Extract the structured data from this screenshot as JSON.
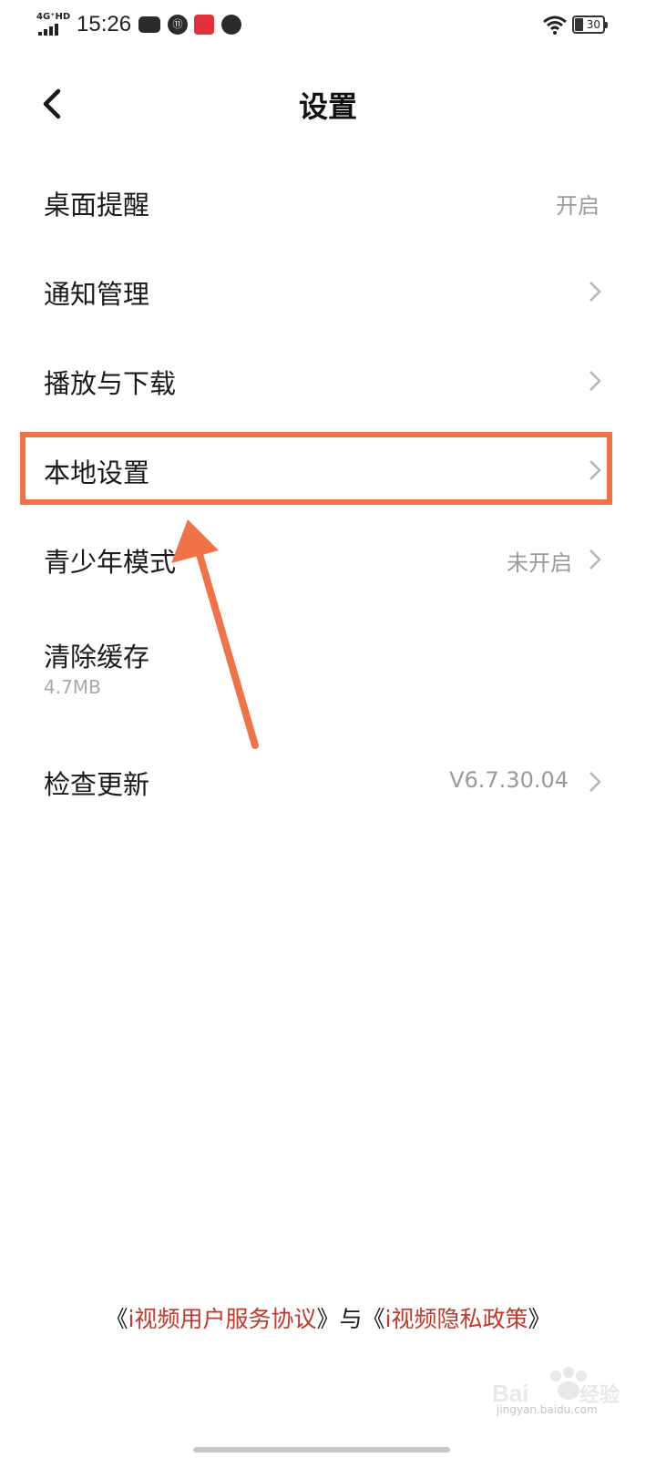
{
  "status_bar": {
    "network": "4G⁺HD",
    "time": "15:26",
    "battery": "30",
    "icons": [
      "car-icon",
      "one-badge-icon",
      "app-red-icon",
      "globe-icon",
      "wifi-icon",
      "battery-icon"
    ]
  },
  "header": {
    "title": "设置",
    "back_icon": "chevron-left-icon"
  },
  "settings": {
    "items": [
      {
        "label": "桌面提醒",
        "value": "开启"
      },
      {
        "label": "通知管理",
        "value": ""
      },
      {
        "label": "播放与下载",
        "value": ""
      },
      {
        "label": "本地设置",
        "value": ""
      },
      {
        "label": "青少年模式",
        "value": "未开启"
      },
      {
        "label": "清除缓存",
        "sub": "4.7MB"
      },
      {
        "label": "检查更新",
        "value": "V6.7.30.04"
      }
    ]
  },
  "footer": {
    "open1": "《",
    "link1": "i视频用户服务协议",
    "close1": "》",
    "conj": "与",
    "open2": "《",
    "link2": "i视频隐私政策",
    "close2": "》"
  },
  "watermark": {
    "text": "jingyan.baidu.com"
  },
  "colors": {
    "highlight": "#f07347",
    "link": "#c0392b",
    "secondary_text": "#9a9a9a"
  }
}
